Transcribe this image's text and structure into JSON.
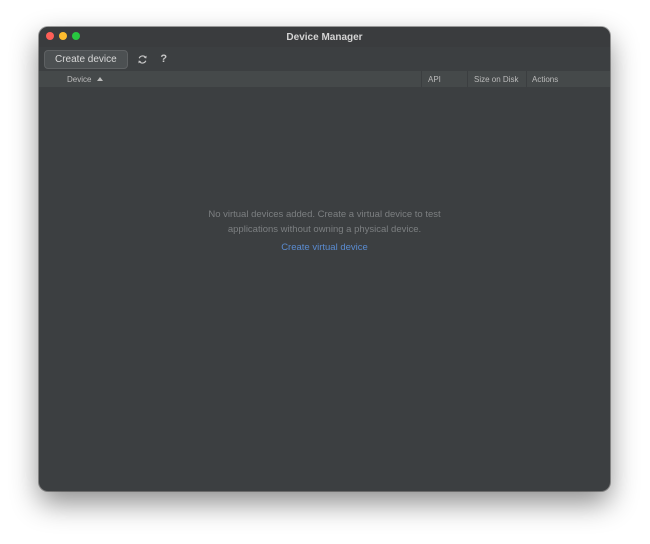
{
  "window": {
    "title": "Device Manager"
  },
  "toolbar": {
    "create_label": "Create device",
    "refresh_icon": "refresh-icon",
    "help_icon": "help-icon",
    "help_label": "?"
  },
  "table": {
    "columns": [
      "Device",
      "API",
      "Size on Disk",
      "Actions"
    ],
    "sort_column": "Device",
    "sort_direction": "ascending"
  },
  "empty_state": {
    "line1": "No virtual devices added. Create a virtual device to test",
    "line2": "applications without owning a physical device.",
    "link": "Create virtual device"
  },
  "colors": {
    "window_bg": "#3c3f41",
    "header_bg": "#45494a",
    "link": "#5a8bd0",
    "close": "#fe5f57",
    "minimize": "#febc2e",
    "zoom": "#28c840"
  }
}
